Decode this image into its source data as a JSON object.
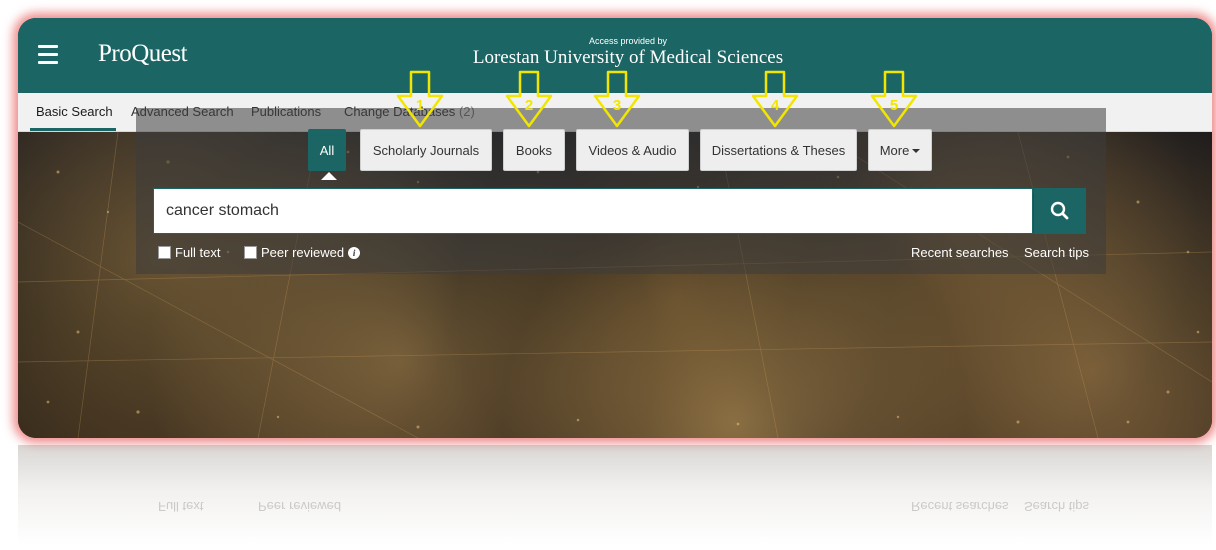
{
  "header": {
    "logo": "ProQuest",
    "access_label": "Access provided by",
    "institution": "Lorestan University of Medical Sciences",
    "icons": [
      "history-icon",
      "folder-icon",
      "user-icon",
      "help-icon"
    ]
  },
  "subnav": {
    "items": [
      {
        "label": "Basic Search",
        "active": true
      },
      {
        "label": "Advanced Search"
      },
      {
        "label": "Publications"
      },
      {
        "label": "Change Databases",
        "count": "(2)"
      }
    ]
  },
  "search": {
    "source_tabs": [
      {
        "label": "All",
        "selected": true
      },
      {
        "label": "Scholarly Journals"
      },
      {
        "label": "Books"
      },
      {
        "label": "Videos & Audio"
      },
      {
        "label": "Dissertations & Theses"
      },
      {
        "label": "More"
      }
    ],
    "query": "cancer stomach",
    "options": {
      "full_text": "Full text",
      "peer_reviewed": "Peer reviewed"
    },
    "links": {
      "recent": "Recent searches",
      "tips": "Search tips"
    }
  },
  "annotations": {
    "arrow_color": "#f2e600",
    "labels": [
      "1",
      "2",
      "3",
      "4",
      "5"
    ]
  },
  "colors": {
    "brand": "#1b6665",
    "frame_glow": "#e65050"
  }
}
